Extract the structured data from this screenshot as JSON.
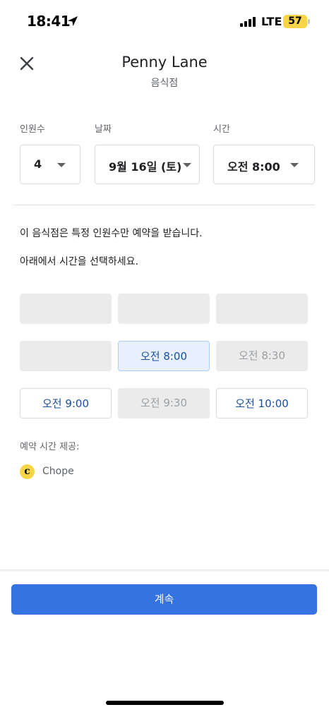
{
  "status_bar": {
    "time": "18:41",
    "network": "LTE",
    "battery": "57",
    "battery_color": "#f7d547"
  },
  "header": {
    "title": "Penny Lane",
    "subtitle": "음식점",
    "close_icon": "close-icon"
  },
  "form": {
    "party_size": {
      "label": "인원수",
      "value": "4"
    },
    "date": {
      "label": "날짜",
      "value": "9월 16일 (토)"
    },
    "time": {
      "label": "시간",
      "value": "오전 8:00"
    }
  },
  "info": {
    "line1": "이 음식점은 특정 인원수만 예약을 받습니다.",
    "line2": "아래에서 시간을 선택하세요."
  },
  "slots": [
    {
      "label": "",
      "state": "empty"
    },
    {
      "label": "",
      "state": "empty"
    },
    {
      "label": "",
      "state": "empty"
    },
    {
      "label": "",
      "state": "empty"
    },
    {
      "label": "오전 8:00",
      "state": "selected"
    },
    {
      "label": "오전 8:30",
      "state": "disabled"
    },
    {
      "label": "오전 9:00",
      "state": "available"
    },
    {
      "label": "오전 9:30",
      "state": "disabled"
    },
    {
      "label": "오전 10:00",
      "state": "available"
    }
  ],
  "provider": {
    "label": "예약 시간 제공:",
    "logo_letter": "c",
    "name": "Chope"
  },
  "continue_label": "계속",
  "colors": {
    "accent": "#3573e0",
    "selected_bg": "#e8f0fe",
    "link_text": "#1a4fa0"
  }
}
